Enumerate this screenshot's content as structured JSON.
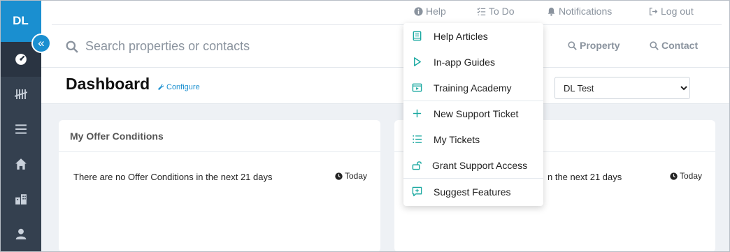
{
  "sidebar": {
    "logo": "DL",
    "items": [
      {
        "icon": "dashboard-gauge-icon",
        "active": true
      },
      {
        "icon": "tally-icon",
        "active": false
      },
      {
        "icon": "list-icon",
        "active": false
      },
      {
        "icon": "home-icon",
        "active": false
      },
      {
        "icon": "buildings-icon",
        "active": false
      },
      {
        "icon": "user-icon",
        "active": false
      }
    ],
    "collapse_icon": "«"
  },
  "topnav": {
    "help": "Help",
    "todo": "To Do",
    "notifications": "Notifications",
    "logout": "Log out"
  },
  "search": {
    "placeholder": "Search properties or contacts",
    "property": "Property",
    "contact": "Contact"
  },
  "dashboard": {
    "title": "Dashboard",
    "configure": "Configure",
    "select_value": "DL Test"
  },
  "cards": [
    {
      "title": "My Offer Conditions",
      "message": "There are no Offer Conditions in the next 21 days",
      "date": "Today"
    },
    {
      "title": "",
      "message": "There are no Offer Conditions in the next 21 days",
      "message_visible": "n the next 21 days",
      "date": "Today"
    }
  ],
  "help_menu": {
    "items": [
      {
        "label": "Help Articles",
        "icon": "book-icon"
      },
      {
        "label": "In-app Guides",
        "icon": "play-icon"
      },
      {
        "label": "Training Academy",
        "icon": "academy-icon"
      },
      {
        "label": "New Support Ticket",
        "icon": "plus-icon"
      },
      {
        "label": "My Tickets",
        "icon": "numbered-list-icon"
      },
      {
        "label": "Grant Support Access",
        "icon": "unlock-icon"
      },
      {
        "label": "Suggest Features",
        "icon": "comment-plus-icon"
      }
    ]
  },
  "colors": {
    "sidebar_bg": "#34404f",
    "brand_blue": "#1a8fd0",
    "menu_icon_teal": "#19a8a0",
    "muted_text": "#8a939e"
  }
}
